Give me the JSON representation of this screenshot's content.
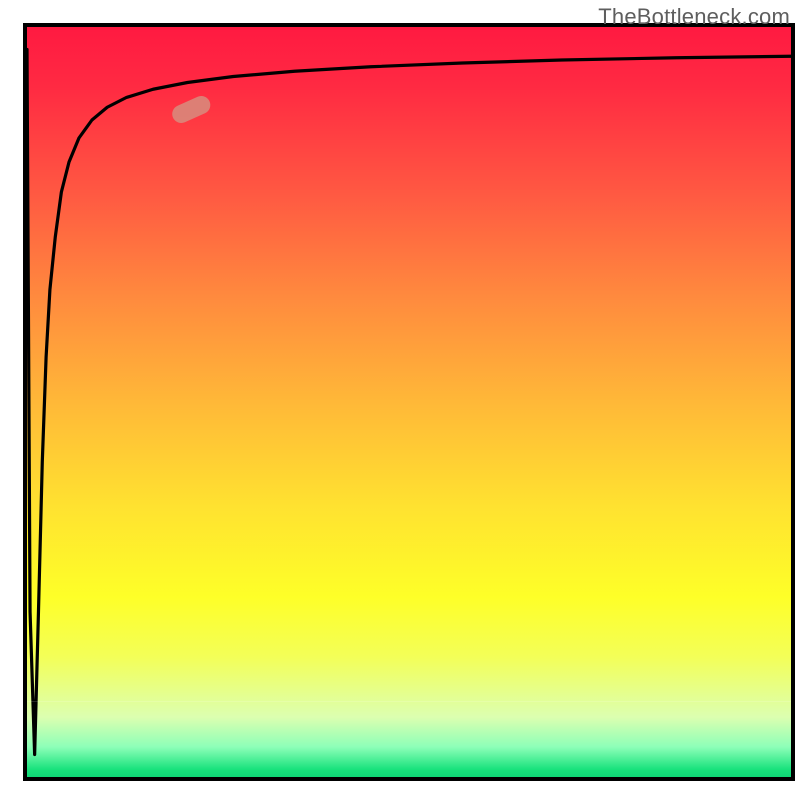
{
  "watermark": "TheBottleneck.com",
  "chart_data": {
    "type": "line",
    "title": "",
    "xlabel": "",
    "ylabel": "",
    "xlim": [
      0,
      100
    ],
    "ylim": [
      0,
      100
    ],
    "background_gradient": {
      "top": "#ff1a41",
      "mid": "#ffe230",
      "bottom": "#18e27c",
      "meaning_top_to_bottom": "high-to-low bottleneck percentage"
    },
    "series": [
      {
        "name": "bottleneck-curve",
        "x": [
          0.0,
          0.4,
          1.0,
          1.5,
          2.0,
          2.5,
          3.0,
          3.7,
          4.5,
          5.5,
          6.8,
          8.5,
          10.5,
          13.0,
          16.5,
          21.0,
          27.0,
          35.0,
          45.0,
          57.0,
          70.0,
          85.0,
          100.0
        ],
        "y": [
          97.0,
          22.0,
          3.0,
          22.0,
          42.0,
          56.0,
          65.0,
          72.0,
          78.0,
          82.0,
          85.2,
          87.6,
          89.3,
          90.6,
          91.7,
          92.6,
          93.4,
          94.1,
          94.7,
          95.2,
          95.6,
          95.9,
          96.1
        ]
      }
    ],
    "marker": {
      "name": "highlighted-point",
      "x_approx": 21.5,
      "y_approx": 89.0,
      "angle_deg": -24,
      "shape": "pill",
      "color": "#d88a7c"
    },
    "grid": false,
    "legend": false
  }
}
